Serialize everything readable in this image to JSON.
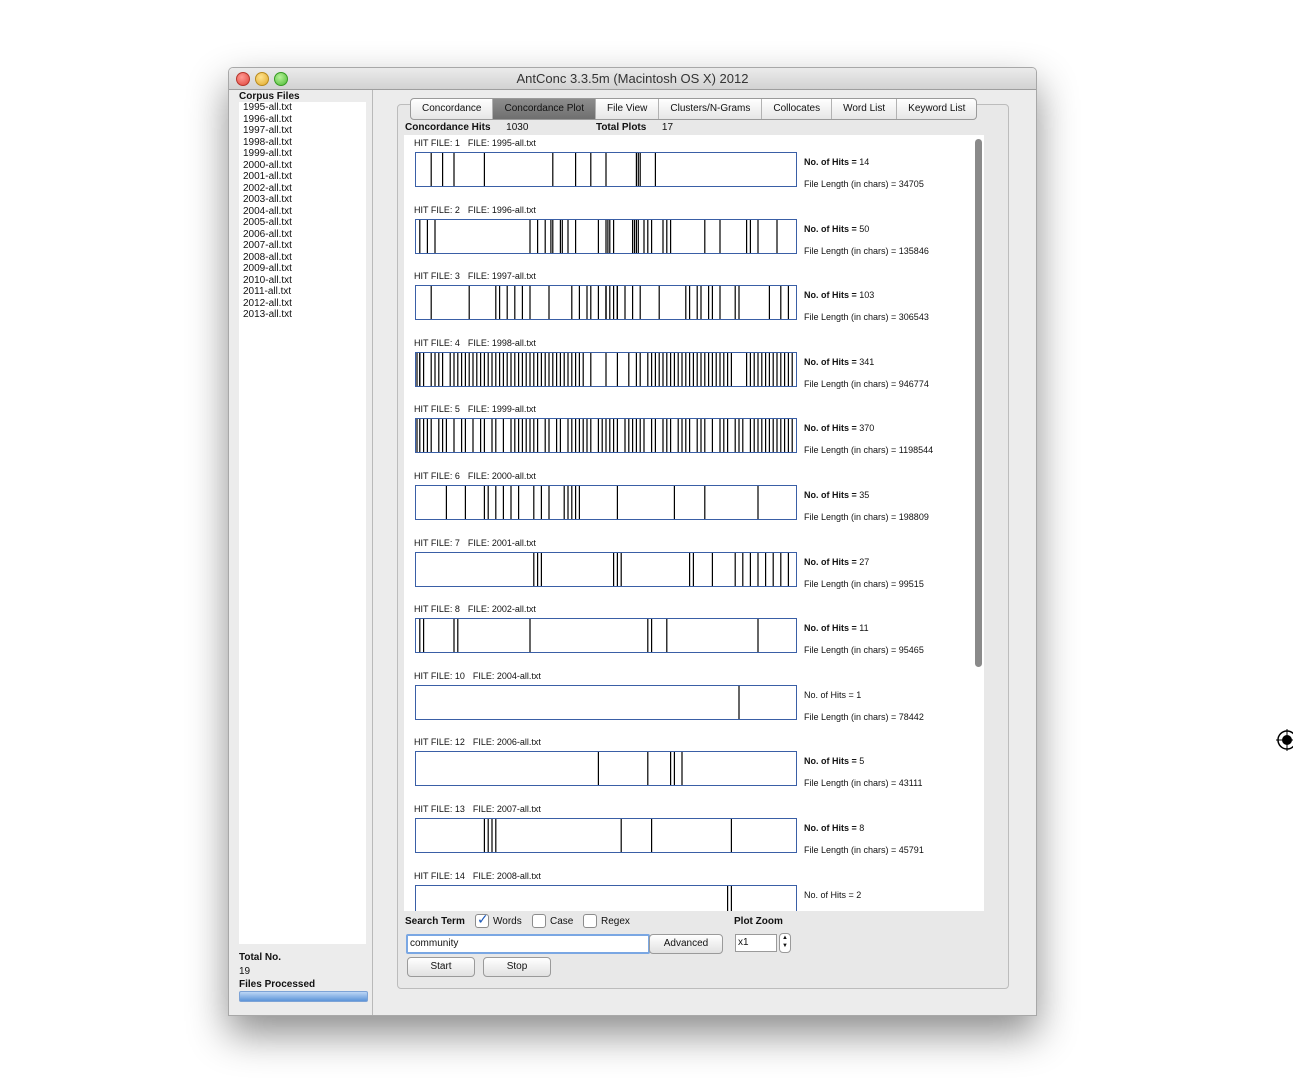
{
  "window": {
    "title": "AntConc 3.3.5m (Macintosh OS X) 2012"
  },
  "corpus": {
    "title": "Corpus Files",
    "files": [
      "1995-all.txt",
      "1996-all.txt",
      "1997-all.txt",
      "1998-all.txt",
      "1999-all.txt",
      "2000-all.txt",
      "2001-all.txt",
      "2002-all.txt",
      "2003-all.txt",
      "2004-all.txt",
      "2005-all.txt",
      "2006-all.txt",
      "2007-all.txt",
      "2008-all.txt",
      "2009-all.txt",
      "2010-all.txt",
      "2011-all.txt",
      "2012-all.txt",
      "2013-all.txt"
    ],
    "total_label": "Total No.",
    "total_value": "19",
    "processed_label": "Files Processed",
    "processed_progress": 1.0
  },
  "tabs": [
    "Concordance",
    "Concordance Plot",
    "File View",
    "Clusters/N-Grams",
    "Collocates",
    "Word List",
    "Keyword List"
  ],
  "active_tab": 1,
  "summary": {
    "hits_label": "Concordance Hits",
    "hits_value": "1030",
    "plots_label": "Total Plots",
    "plots_value": "17"
  },
  "plots": [
    {
      "hit_file": "HIT FILE: 1",
      "file": "FILE: 1995-all.txt",
      "hits_key": "No. of Hits =",
      "hits": "14",
      "bold": true,
      "length_text": "File Length (in chars) = 34705",
      "marks": [
        0.04,
        0.07,
        0.1,
        0.18,
        0.36,
        0.42,
        0.46,
        0.5,
        0.58,
        0.585,
        0.59,
        0.63
      ]
    },
    {
      "hit_file": "HIT FILE: 2",
      "file": "FILE: 1996-all.txt",
      "hits_key": "No. of Hits =",
      "hits": "50",
      "bold": true,
      "length_text": "File Length (in chars) = 135846",
      "marks": [
        0.01,
        0.03,
        0.05,
        0.3,
        0.32,
        0.34,
        0.355,
        0.36,
        0.38,
        0.385,
        0.4,
        0.42,
        0.48,
        0.5,
        0.505,
        0.51,
        0.52,
        0.57,
        0.575,
        0.58,
        0.585,
        0.6,
        0.61,
        0.62,
        0.65,
        0.66,
        0.67,
        0.76,
        0.8,
        0.87,
        0.88,
        0.9,
        0.95
      ]
    },
    {
      "hit_file": "HIT FILE: 3",
      "file": "FILE: 1997-all.txt",
      "hits_key": "No. of Hits =",
      "hits": "103",
      "bold": true,
      "length_text": "File Length (in chars) = 306543",
      "marks": [
        0.04,
        0.14,
        0.21,
        0.22,
        0.24,
        0.26,
        0.28,
        0.3,
        0.35,
        0.41,
        0.43,
        0.45,
        0.46,
        0.48,
        0.5,
        0.5,
        0.5,
        0.51,
        0.52,
        0.53,
        0.53,
        0.53,
        0.55,
        0.57,
        0.59,
        0.64,
        0.71,
        0.72,
        0.74,
        0.75,
        0.77,
        0.78,
        0.8,
        0.84,
        0.85,
        0.93,
        0.96,
        0.98
      ]
    },
    {
      "hit_file": "HIT FILE: 4",
      "file": "FILE: 1998-all.txt",
      "hits_key": "No. of Hits =",
      "hits": "341",
      "bold": true,
      "length_text": "File Length (in chars) = 946774",
      "marks": [
        0.0,
        0.01,
        0.01,
        0.02,
        0.04,
        0.05,
        0.06,
        0.07,
        0.09,
        0.1,
        0.11,
        0.12,
        0.13,
        0.14,
        0.15,
        0.16,
        0.17,
        0.18,
        0.19,
        0.2,
        0.21,
        0.22,
        0.23,
        0.24,
        0.25,
        0.26,
        0.27,
        0.28,
        0.29,
        0.3,
        0.31,
        0.32,
        0.33,
        0.34,
        0.35,
        0.36,
        0.37,
        0.38,
        0.39,
        0.4,
        0.41,
        0.42,
        0.43,
        0.44,
        0.46,
        0.5,
        0.53,
        0.56,
        0.58,
        0.59,
        0.61,
        0.62,
        0.63,
        0.64,
        0.65,
        0.66,
        0.67,
        0.68,
        0.69,
        0.7,
        0.71,
        0.72,
        0.73,
        0.74,
        0.75,
        0.76,
        0.77,
        0.78,
        0.79,
        0.8,
        0.81,
        0.82,
        0.83,
        0.87,
        0.88,
        0.89,
        0.9,
        0.91,
        0.92,
        0.93,
        0.94,
        0.95,
        0.96,
        0.97,
        0.98,
        0.99
      ]
    },
    {
      "hit_file": "HIT FILE: 5",
      "file": "FILE: 1999-all.txt",
      "hits_key": "No. of Hits =",
      "hits": "370",
      "bold": true,
      "length_text": "File Length (in chars) = 1198544",
      "marks": [
        0.0,
        0.01,
        0.02,
        0.03,
        0.04,
        0.06,
        0.07,
        0.08,
        0.1,
        0.12,
        0.13,
        0.15,
        0.17,
        0.18,
        0.2,
        0.21,
        0.23,
        0.25,
        0.26,
        0.27,
        0.28,
        0.29,
        0.3,
        0.31,
        0.32,
        0.34,
        0.35,
        0.37,
        0.38,
        0.4,
        0.41,
        0.42,
        0.43,
        0.44,
        0.45,
        0.46,
        0.48,
        0.49,
        0.5,
        0.51,
        0.52,
        0.53,
        0.55,
        0.56,
        0.57,
        0.58,
        0.59,
        0.6,
        0.62,
        0.63,
        0.65,
        0.66,
        0.67,
        0.69,
        0.7,
        0.71,
        0.72,
        0.74,
        0.75,
        0.76,
        0.78,
        0.8,
        0.81,
        0.82,
        0.84,
        0.85,
        0.86,
        0.88,
        0.89,
        0.9,
        0.91,
        0.92,
        0.93,
        0.94,
        0.95,
        0.96,
        0.97,
        0.98,
        0.99
      ]
    },
    {
      "hit_file": "HIT FILE: 6",
      "file": "FILE: 2000-all.txt",
      "hits_key": "No. of Hits =",
      "hits": "35",
      "bold": true,
      "length_text": "File Length (in chars) = 198809",
      "marks": [
        0.08,
        0.13,
        0.18,
        0.19,
        0.21,
        0.23,
        0.25,
        0.27,
        0.31,
        0.33,
        0.35,
        0.39,
        0.4,
        0.41,
        0.42,
        0.43,
        0.53,
        0.68,
        0.76,
        0.9
      ]
    },
    {
      "hit_file": "HIT FILE: 7",
      "file": "FILE: 2001-all.txt",
      "hits_key": "No. of Hits =",
      "hits": "27",
      "bold": true,
      "length_text": "File Length (in chars) = 99515",
      "marks": [
        0.31,
        0.32,
        0.33,
        0.52,
        0.53,
        0.54,
        0.72,
        0.73,
        0.78,
        0.84,
        0.86,
        0.88,
        0.9,
        0.92,
        0.94,
        0.96,
        0.98
      ]
    },
    {
      "hit_file": "HIT FILE: 8",
      "file": "FILE: 2002-all.txt",
      "hits_key": "No. of Hits =",
      "hits": "11",
      "bold": true,
      "length_text": "File Length (in chars) = 95465",
      "marks": [
        0.01,
        0.02,
        0.1,
        0.11,
        0.3,
        0.61,
        0.62,
        0.66,
        0.9
      ]
    },
    {
      "hit_file": "HIT FILE: 10",
      "file": "FILE: 2004-all.txt",
      "hits_key": "No. of Hits =",
      "hits": "1",
      "bold": false,
      "length_text": "File Length (in chars) = 78442",
      "marks": [
        0.85
      ]
    },
    {
      "hit_file": "HIT FILE: 12",
      "file": "FILE: 2006-all.txt",
      "hits_key": "No. of Hits =",
      "hits": "5",
      "bold": true,
      "length_text": "File Length (in chars) = 43111",
      "marks": [
        0.48,
        0.61,
        0.67,
        0.68,
        0.7
      ]
    },
    {
      "hit_file": "HIT FILE: 13",
      "file": "FILE: 2007-all.txt",
      "hits_key": "No. of Hits =",
      "hits": "8",
      "bold": true,
      "length_text": "File Length (in chars) = 45791",
      "marks": [
        0.18,
        0.19,
        0.2,
        0.21,
        0.54,
        0.62,
        0.83
      ]
    },
    {
      "hit_file": "HIT FILE: 14",
      "file": "FILE: 2008-all.txt",
      "hits_key": "No. of Hits =",
      "hits": "2",
      "bold": false,
      "length_text": "",
      "marks": [
        0.82,
        0.83
      ]
    }
  ],
  "controls": {
    "search_term_label": "Search Term",
    "words_label": "Words",
    "words_checked": true,
    "case_label": "Case",
    "case_checked": false,
    "regex_label": "Regex",
    "regex_checked": false,
    "search_value": "community",
    "advanced_label": "Advanced",
    "plot_zoom_label": "Plot Zoom",
    "zoom_value": "x1",
    "start_label": "Start",
    "stop_label": "Stop"
  }
}
